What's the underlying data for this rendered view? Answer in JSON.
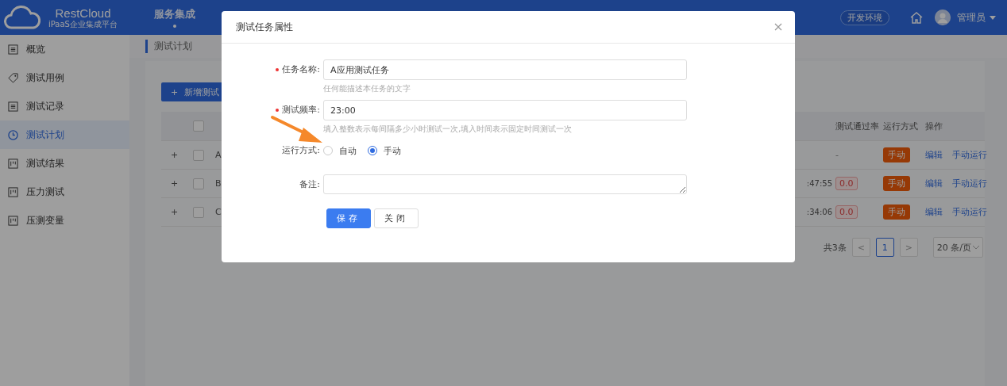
{
  "header": {
    "logo_title": "RestCloud",
    "logo_subtitle": "iPaaS企业集成平台",
    "nav": [
      {
        "label": "服务集成",
        "selected": true
      }
    ],
    "env_badge": "开发环境",
    "user_name": "管理员"
  },
  "sidebar": {
    "items": [
      {
        "label": "概览",
        "kind": "doc",
        "selected": false
      },
      {
        "label": "测试用例",
        "kind": "tag",
        "selected": false
      },
      {
        "label": "测试记录",
        "kind": "doc",
        "selected": false
      },
      {
        "label": "测试计划",
        "kind": "clock",
        "selected": true
      },
      {
        "label": "测试结果",
        "kind": "chart",
        "selected": false
      },
      {
        "label": "压力测试",
        "kind": "chart",
        "selected": false
      },
      {
        "label": "压测变量",
        "kind": "chart",
        "selected": false
      }
    ]
  },
  "breadcrumb": "测试计划",
  "add_button": {
    "icon": "+",
    "label": "新增测试"
  },
  "table": {
    "header_checked": false,
    "columns": [
      "测试通过率",
      "运行方式",
      "操作"
    ],
    "rows": [
      {
        "expand": "+",
        "checked": false,
        "name": "A",
        "rate": {
          "kind": "plain",
          "text": "-"
        },
        "mode": "手动",
        "actions": [
          "编辑",
          "手动运行"
        ]
      },
      {
        "expand": "+",
        "checked": false,
        "name": "B",
        "time": ":47:55",
        "rate": {
          "kind": "tag",
          "text": "0.0"
        },
        "mode": "手动",
        "actions": [
          "编辑",
          "手动运行"
        ]
      },
      {
        "expand": "+",
        "checked": false,
        "name": "C",
        "time": ":34:06",
        "rate": {
          "kind": "tag",
          "text": "0.0"
        },
        "mode": "手动",
        "actions": [
          "编辑",
          "手动运行"
        ]
      }
    ]
  },
  "pagination": {
    "total": "共3条",
    "prev": "<",
    "pages": [
      {
        "label": "1",
        "selected": true
      }
    ],
    "next": ">",
    "page_size": "20 条/页"
  },
  "modal": {
    "title": "测试任务属性",
    "fields": [
      {
        "kind": "input",
        "label": "任务名称:",
        "required": true,
        "value": "A应用测试任务",
        "hint": "任何能描述本任务的文字"
      },
      {
        "kind": "input",
        "label": "测试频率:",
        "required": true,
        "value": "23:00",
        "hint": "填入整数表示每间隔多少小时测试一次,填入时间表示固定时间测试一次"
      },
      {
        "kind": "radio",
        "label": "运行方式:",
        "required": false,
        "options": [
          {
            "label": "自动",
            "selected": false
          },
          {
            "label": "手动",
            "selected": true
          }
        ]
      },
      {
        "kind": "textarea",
        "label": "备注:",
        "required": false
      }
    ],
    "buttons": [
      {
        "kind": "primary",
        "label": "保存"
      },
      {
        "kind": "default",
        "label": "关闭"
      }
    ]
  }
}
